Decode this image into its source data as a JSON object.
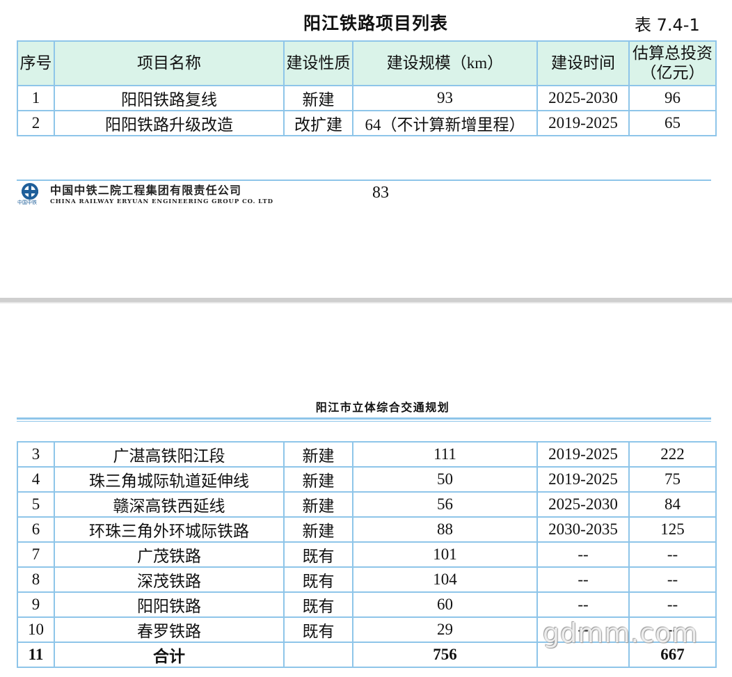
{
  "title": "阳江铁路项目列表",
  "table_no": "表 7.4-1",
  "columns": [
    "序号",
    "项目名称",
    "建设性质",
    "建设规模（km）",
    "建设时间",
    "估算总投资",
    "（亿元）"
  ],
  "rows": [
    [
      "1",
      "阳阳铁路复线",
      "新建",
      "93",
      "2025-2030",
      "96"
    ],
    [
      "2",
      "阳阳铁路升级改造",
      "改扩建",
      "64（不计算新增里程）",
      "2019-2025",
      "65"
    ],
    [
      "3",
      "广湛高铁阳江段",
      "新建",
      "111",
      "2019-2025",
      "222"
    ],
    [
      "4",
      "珠三角城际轨道延伸线",
      "新建",
      "50",
      "2019-2025",
      "75"
    ],
    [
      "5",
      "赣深高铁西延线",
      "新建",
      "56",
      "2025-2030",
      "84"
    ],
    [
      "6",
      "环珠三角外环城际铁路",
      "新建",
      "88",
      "2030-2035",
      "125"
    ],
    [
      "7",
      "广茂铁路",
      "既有",
      "101",
      "--",
      "--"
    ],
    [
      "8",
      "深茂铁路",
      "既有",
      "104",
      "--",
      "--"
    ],
    [
      "9",
      "阳阳铁路",
      "既有",
      "60",
      "--",
      "--"
    ],
    [
      "10",
      "春罗铁路",
      "既有",
      "29",
      "--",
      "--"
    ]
  ],
  "total": [
    "11",
    "合计",
    "",
    "756",
    "",
    "667"
  ],
  "footer": {
    "logo_text": "中国中铁",
    "company_cn": "中国中铁二院工程集团有限责任公司",
    "company_en": "CHINA RAILWAY ERYUAN ENGINEERING GROUP CO. LTD",
    "page_number": "83"
  },
  "next_page_header": "阳江市立体综合交通规划",
  "watermark": "gdmm.com"
}
